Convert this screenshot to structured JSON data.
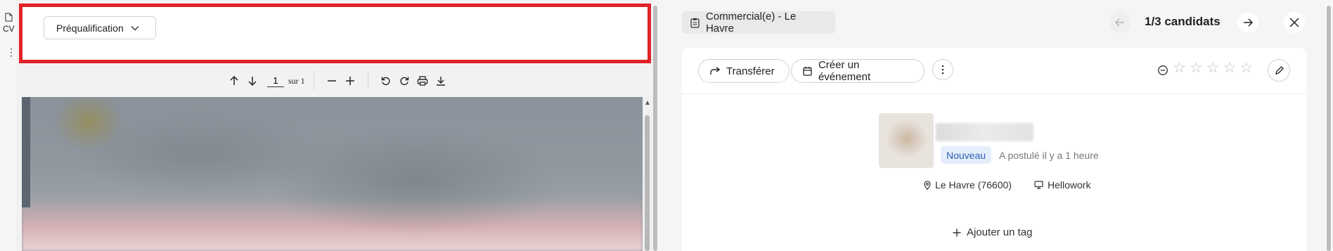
{
  "rail": {
    "doc_label": "CV",
    "more_glyph": "⋮"
  },
  "header": {
    "stage_select": "Préqualification"
  },
  "pdf_toolbar": {
    "page_value": "1",
    "page_total": "sur 1"
  },
  "job": {
    "title": "Commercial(e) - Le Havre"
  },
  "nav": {
    "counter": "1/3 candidats"
  },
  "actions": {
    "transfer": "Transférer",
    "create_event": "Créer un événement"
  },
  "rating": {
    "stars": [
      "☆",
      "☆",
      "☆",
      "☆",
      "☆"
    ],
    "value": 0,
    "max": 5
  },
  "candidate": {
    "status": "Nouveau",
    "applied": "A postulé il y a 1 heure",
    "location": "Le Havre (76600)",
    "source": "Hellowork",
    "add_tag": "Ajouter un tag"
  },
  "colors": {
    "highlight_border": "#e12228",
    "badge_bg": "#e4eefb",
    "badge_text": "#2f5fb0"
  },
  "icons": [
    "file-icon",
    "more-vertical-icon",
    "chevron-down-icon",
    "arrow-up-icon",
    "arrow-down-icon",
    "minus-icon",
    "plus-icon",
    "rotate-left-icon",
    "rotate-right-icon",
    "print-icon",
    "download-icon",
    "clipboard-icon",
    "arrow-left-icon",
    "arrow-right-icon",
    "close-icon",
    "share-forward-icon",
    "calendar-icon",
    "more-vertical-icon",
    "minus-circle-icon",
    "star-icon",
    "pencil-icon",
    "map-pin-icon",
    "monitor-icon",
    "plus-icon"
  ]
}
